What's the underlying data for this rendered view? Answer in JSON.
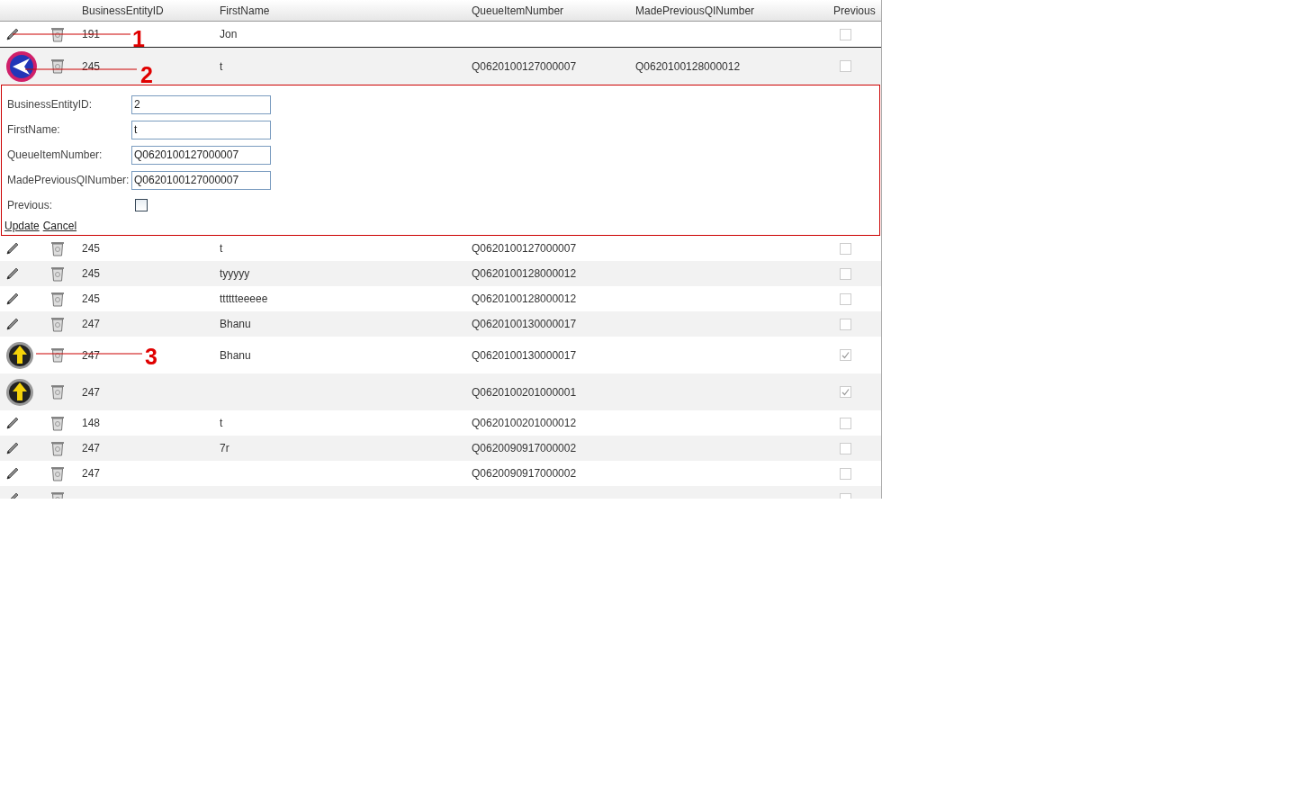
{
  "table": {
    "columns": [
      "BusinessEntityID",
      "FirstName",
      "QueueItemNumber",
      "MadePreviousQINumber",
      "Previous"
    ],
    "rows": [
      {
        "kind": "edit",
        "cells": [
          "191",
          "Jon",
          "",
          ""
        ],
        "previous": false
      },
      {
        "kind": "back",
        "cells": [
          "245",
          "t",
          "Q0620100127000007",
          "Q0620100128000012"
        ],
        "previous": false
      },
      {
        "kind": "form"
      },
      {
        "kind": "edit",
        "cells": [
          "245",
          "t",
          "Q0620100127000007",
          ""
        ],
        "previous": false
      },
      {
        "kind": "edit",
        "cells": [
          "245",
          "tyyyyy",
          "Q0620100128000012",
          ""
        ],
        "previous": false
      },
      {
        "kind": "edit",
        "cells": [
          "245",
          "tttttteeeee",
          "Q0620100128000012",
          ""
        ],
        "previous": false
      },
      {
        "kind": "edit",
        "cells": [
          "247",
          "Bhanu",
          "Q0620100130000017",
          ""
        ],
        "previous": false
      },
      {
        "kind": "up",
        "cells": [
          "247",
          "Bhanu",
          "Q0620100130000017",
          ""
        ],
        "previous": true
      },
      {
        "kind": "up",
        "cells": [
          "247",
          "",
          "Q0620100201000001",
          ""
        ],
        "previous": true
      },
      {
        "kind": "edit",
        "cells": [
          "148",
          "t",
          "Q0620100201000012",
          ""
        ],
        "previous": false
      },
      {
        "kind": "edit",
        "cells": [
          "247",
          "7r",
          "Q0620090917000002",
          ""
        ],
        "previous": false
      },
      {
        "kind": "edit",
        "cells": [
          "247",
          "",
          "Q0620090917000002",
          ""
        ],
        "previous": false
      },
      {
        "kind": "edit",
        "cells": [
          "",
          "",
          "",
          ""
        ],
        "previous": false
      }
    ]
  },
  "edit_form": {
    "fields": [
      {
        "kind": "text",
        "label": "BusinessEntityID:",
        "value": "2"
      },
      {
        "kind": "text",
        "label": "FirstName:",
        "value": "t"
      },
      {
        "kind": "text",
        "label": "QueueItemNumber:",
        "value": "Q0620100127000007"
      },
      {
        "kind": "text",
        "label": "MadePreviousQINumber:",
        "value": "Q0620100127000007"
      },
      {
        "kind": "checkbox",
        "label": "Previous:",
        "checked": false
      }
    ],
    "links": [
      "Update",
      "Cancel"
    ]
  },
  "annotations": [
    "1",
    "2",
    "3"
  ]
}
